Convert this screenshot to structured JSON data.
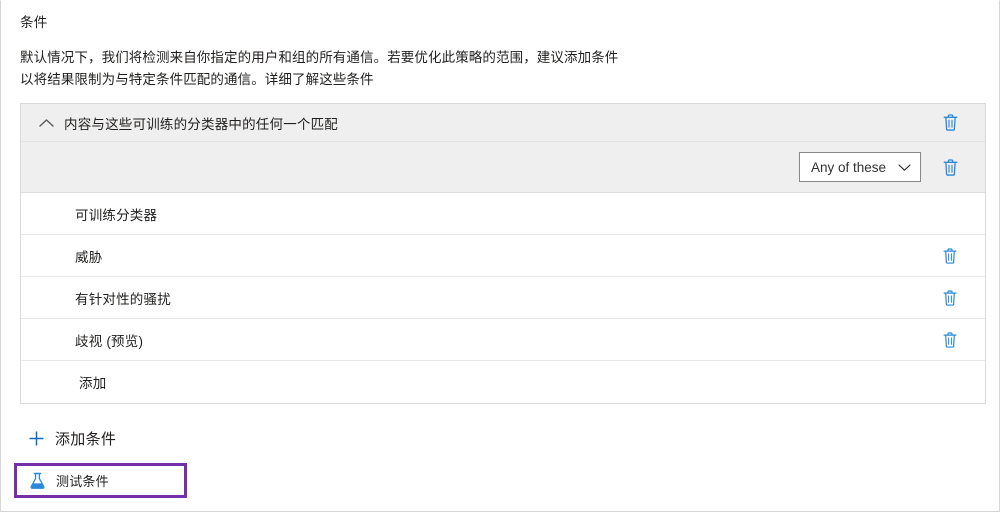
{
  "section": {
    "title": "条件",
    "description_lines": [
      "默认情况下，我们将检测来自你指定的用户和组的所有通信。若要优化此策略的范围，建议添加条件",
      "以将结果限制为与特定条件匹配的通信。详细了解这些条件"
    ]
  },
  "panel": {
    "header": {
      "label": "内容与这些可训练的分类器中的任何一个匹配",
      "collapse_icon": "chevron-up-icon",
      "delete_icon": "trash-icon"
    },
    "operator": {
      "selected": "Any of these",
      "chevron_icon": "chevron-down-icon",
      "delete_icon": "trash-icon"
    },
    "rows": [
      {
        "label": "可训练分类器",
        "has_delete": false,
        "indented": false
      },
      {
        "label": "威胁",
        "has_delete": true,
        "indented": false
      },
      {
        "label": "有针对性的骚扰",
        "has_delete": true,
        "indented": false
      },
      {
        "label": "歧视 (预览)",
        "has_delete": true,
        "indented": false
      },
      {
        "label": "添加",
        "has_delete": false,
        "indented": true
      }
    ]
  },
  "actions": {
    "add_condition": {
      "label": "添加条件",
      "icon": "plus-icon"
    },
    "test_condition": {
      "label": "测试条件",
      "icon": "flask-icon",
      "highlight_color": "#7430a8"
    }
  },
  "colors": {
    "accent_blue": "#0f6cbd",
    "icon_blue": "#2b88d8",
    "panel_header_bg": "#efefef",
    "border": "#d9d9d9",
    "text": "#201f1e",
    "highlight_purple": "#7430a8"
  }
}
